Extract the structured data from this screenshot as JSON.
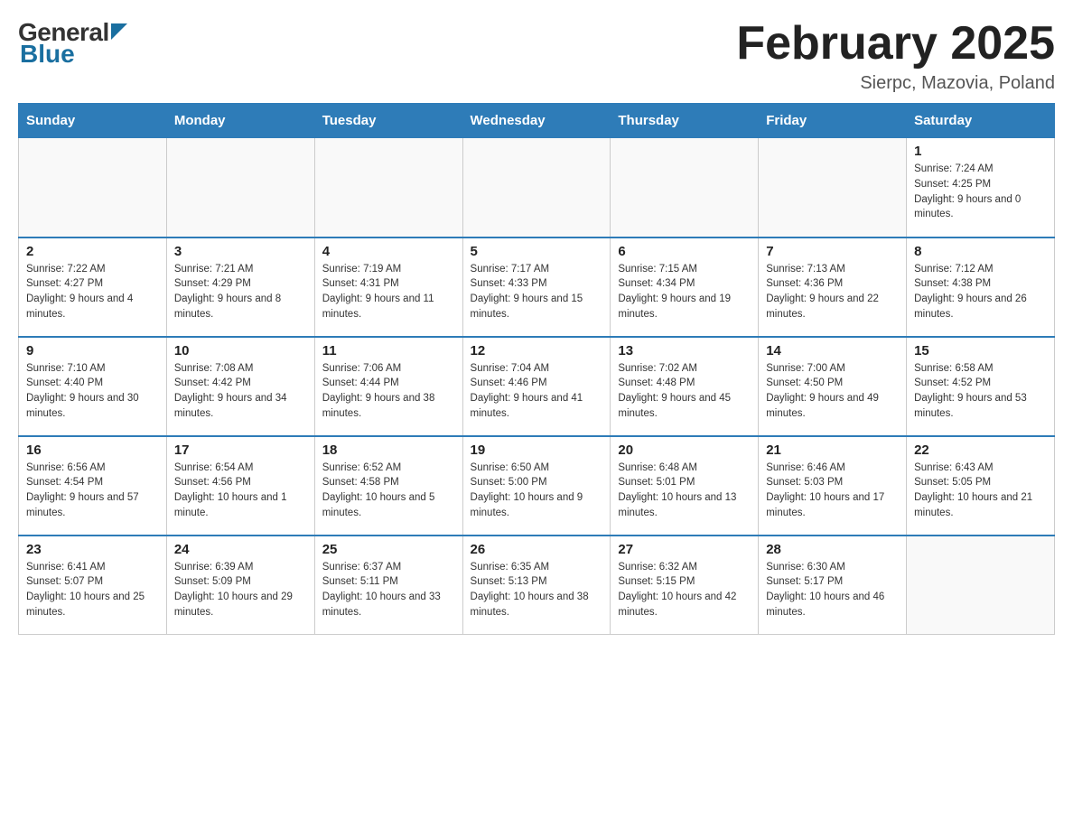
{
  "header": {
    "logo_general": "General",
    "logo_blue": "Blue",
    "title": "February 2025",
    "subtitle": "Sierpc, Mazovia, Poland"
  },
  "days_of_week": [
    "Sunday",
    "Monday",
    "Tuesday",
    "Wednesday",
    "Thursday",
    "Friday",
    "Saturday"
  ],
  "weeks": [
    [
      {
        "day": "",
        "info": ""
      },
      {
        "day": "",
        "info": ""
      },
      {
        "day": "",
        "info": ""
      },
      {
        "day": "",
        "info": ""
      },
      {
        "day": "",
        "info": ""
      },
      {
        "day": "",
        "info": ""
      },
      {
        "day": "1",
        "info": "Sunrise: 7:24 AM\nSunset: 4:25 PM\nDaylight: 9 hours and 0 minutes."
      }
    ],
    [
      {
        "day": "2",
        "info": "Sunrise: 7:22 AM\nSunset: 4:27 PM\nDaylight: 9 hours and 4 minutes."
      },
      {
        "day": "3",
        "info": "Sunrise: 7:21 AM\nSunset: 4:29 PM\nDaylight: 9 hours and 8 minutes."
      },
      {
        "day": "4",
        "info": "Sunrise: 7:19 AM\nSunset: 4:31 PM\nDaylight: 9 hours and 11 minutes."
      },
      {
        "day": "5",
        "info": "Sunrise: 7:17 AM\nSunset: 4:33 PM\nDaylight: 9 hours and 15 minutes."
      },
      {
        "day": "6",
        "info": "Sunrise: 7:15 AM\nSunset: 4:34 PM\nDaylight: 9 hours and 19 minutes."
      },
      {
        "day": "7",
        "info": "Sunrise: 7:13 AM\nSunset: 4:36 PM\nDaylight: 9 hours and 22 minutes."
      },
      {
        "day": "8",
        "info": "Sunrise: 7:12 AM\nSunset: 4:38 PM\nDaylight: 9 hours and 26 minutes."
      }
    ],
    [
      {
        "day": "9",
        "info": "Sunrise: 7:10 AM\nSunset: 4:40 PM\nDaylight: 9 hours and 30 minutes."
      },
      {
        "day": "10",
        "info": "Sunrise: 7:08 AM\nSunset: 4:42 PM\nDaylight: 9 hours and 34 minutes."
      },
      {
        "day": "11",
        "info": "Sunrise: 7:06 AM\nSunset: 4:44 PM\nDaylight: 9 hours and 38 minutes."
      },
      {
        "day": "12",
        "info": "Sunrise: 7:04 AM\nSunset: 4:46 PM\nDaylight: 9 hours and 41 minutes."
      },
      {
        "day": "13",
        "info": "Sunrise: 7:02 AM\nSunset: 4:48 PM\nDaylight: 9 hours and 45 minutes."
      },
      {
        "day": "14",
        "info": "Sunrise: 7:00 AM\nSunset: 4:50 PM\nDaylight: 9 hours and 49 minutes."
      },
      {
        "day": "15",
        "info": "Sunrise: 6:58 AM\nSunset: 4:52 PM\nDaylight: 9 hours and 53 minutes."
      }
    ],
    [
      {
        "day": "16",
        "info": "Sunrise: 6:56 AM\nSunset: 4:54 PM\nDaylight: 9 hours and 57 minutes."
      },
      {
        "day": "17",
        "info": "Sunrise: 6:54 AM\nSunset: 4:56 PM\nDaylight: 10 hours and 1 minute."
      },
      {
        "day": "18",
        "info": "Sunrise: 6:52 AM\nSunset: 4:58 PM\nDaylight: 10 hours and 5 minutes."
      },
      {
        "day": "19",
        "info": "Sunrise: 6:50 AM\nSunset: 5:00 PM\nDaylight: 10 hours and 9 minutes."
      },
      {
        "day": "20",
        "info": "Sunrise: 6:48 AM\nSunset: 5:01 PM\nDaylight: 10 hours and 13 minutes."
      },
      {
        "day": "21",
        "info": "Sunrise: 6:46 AM\nSunset: 5:03 PM\nDaylight: 10 hours and 17 minutes."
      },
      {
        "day": "22",
        "info": "Sunrise: 6:43 AM\nSunset: 5:05 PM\nDaylight: 10 hours and 21 minutes."
      }
    ],
    [
      {
        "day": "23",
        "info": "Sunrise: 6:41 AM\nSunset: 5:07 PM\nDaylight: 10 hours and 25 minutes."
      },
      {
        "day": "24",
        "info": "Sunrise: 6:39 AM\nSunset: 5:09 PM\nDaylight: 10 hours and 29 minutes."
      },
      {
        "day": "25",
        "info": "Sunrise: 6:37 AM\nSunset: 5:11 PM\nDaylight: 10 hours and 33 minutes."
      },
      {
        "day": "26",
        "info": "Sunrise: 6:35 AM\nSunset: 5:13 PM\nDaylight: 10 hours and 38 minutes."
      },
      {
        "day": "27",
        "info": "Sunrise: 6:32 AM\nSunset: 5:15 PM\nDaylight: 10 hours and 42 minutes."
      },
      {
        "day": "28",
        "info": "Sunrise: 6:30 AM\nSunset: 5:17 PM\nDaylight: 10 hours and 46 minutes."
      },
      {
        "day": "",
        "info": ""
      }
    ]
  ]
}
